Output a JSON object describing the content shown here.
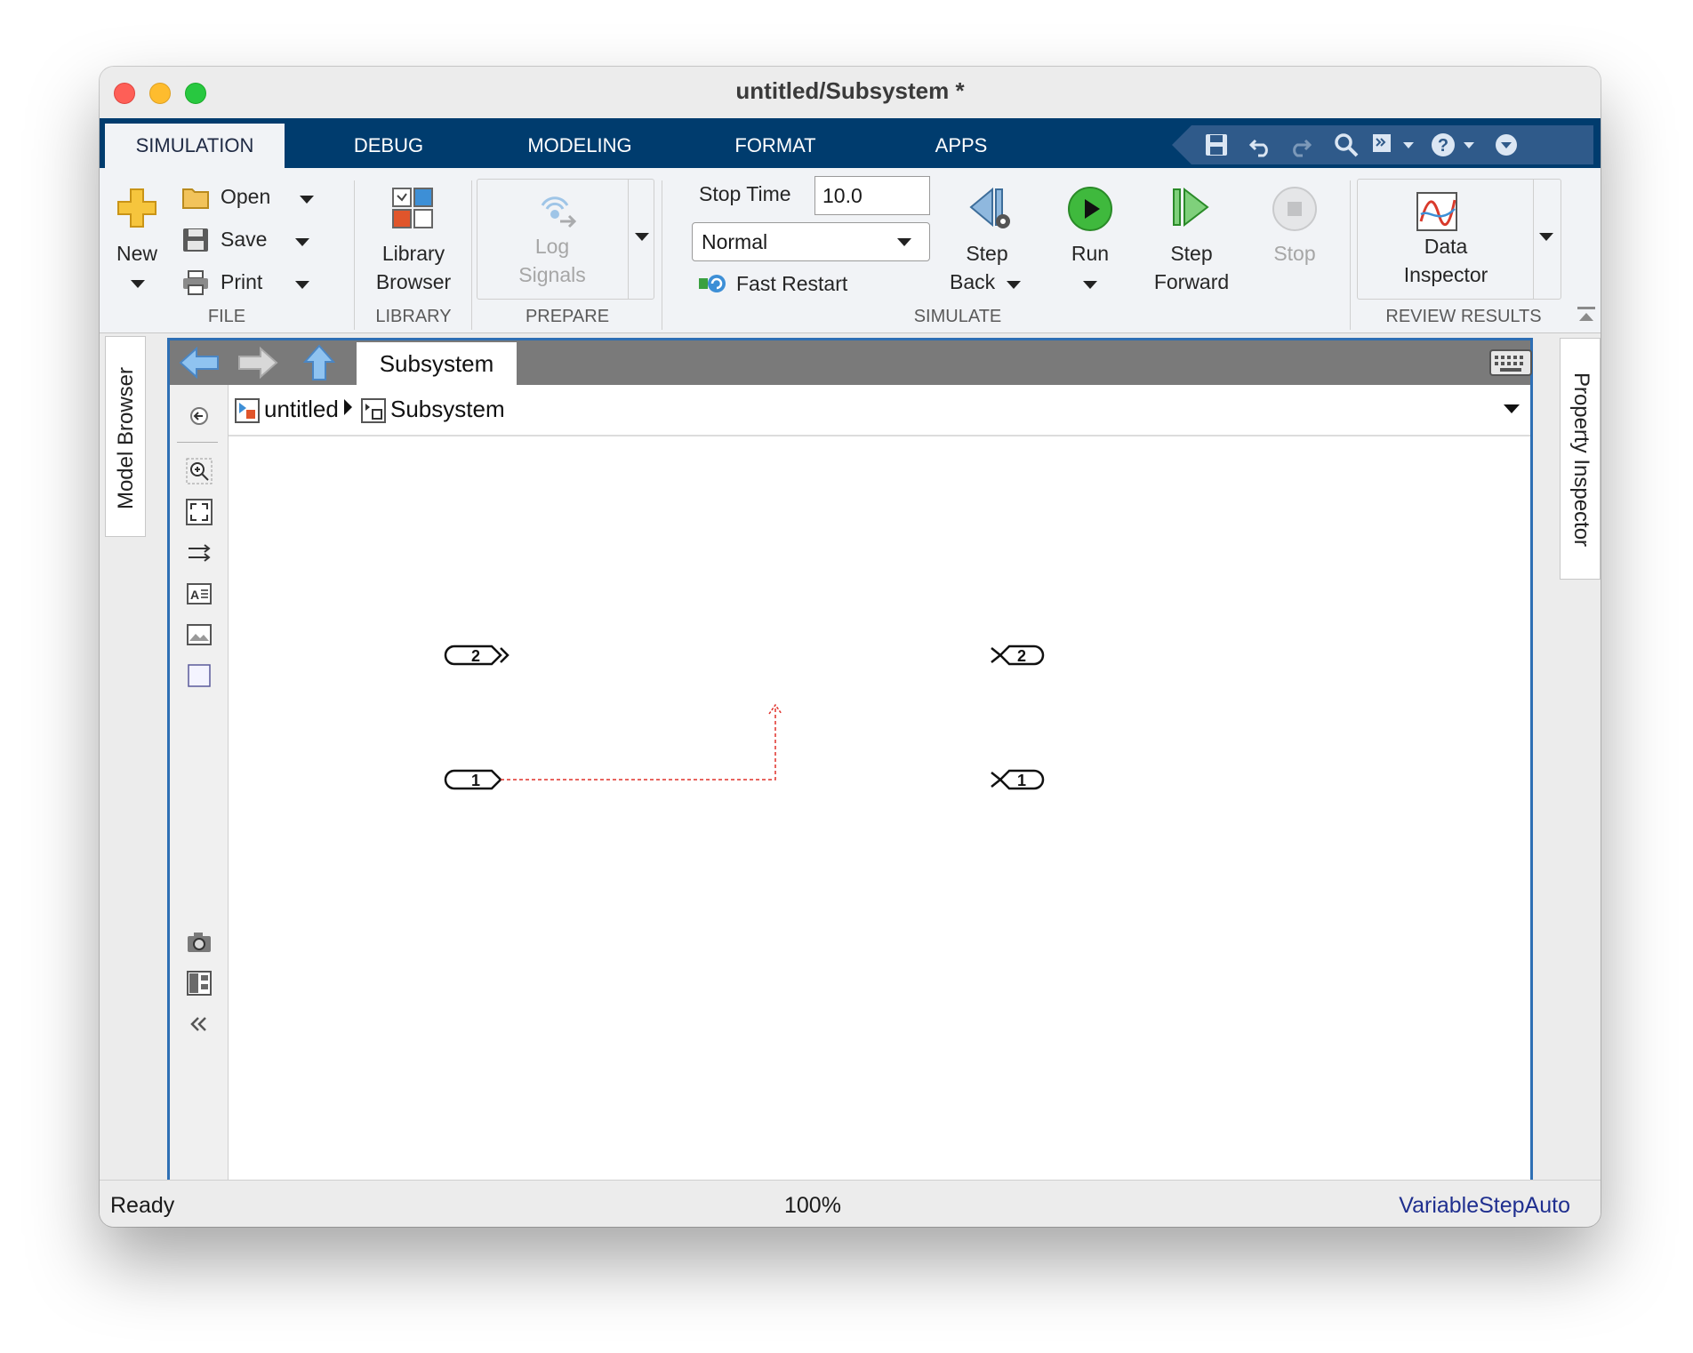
{
  "window": {
    "title": "untitled/Subsystem *"
  },
  "tabs": [
    {
      "label": "SIMULATION",
      "active": true
    },
    {
      "label": "DEBUG"
    },
    {
      "label": "MODELING"
    },
    {
      "label": "FORMAT"
    },
    {
      "label": "APPS"
    }
  ],
  "quick_access": [
    "save-icon",
    "undo-icon",
    "redo-icon",
    "search-icon",
    "apps-icon",
    "help-icon",
    "expand-icon"
  ],
  "ribbon": {
    "file": {
      "new_label": "New",
      "open_label": "Open",
      "save_label": "Save",
      "print_label": "Print",
      "group_title": "FILE"
    },
    "library": {
      "button_line1": "Library",
      "button_line2": "Browser",
      "group_title": "LIBRARY"
    },
    "prepare": {
      "button_line1": "Log",
      "button_line2": "Signals",
      "group_title": "PREPARE"
    },
    "simulate": {
      "stop_time_label": "Stop Time",
      "stop_time_value": "10.0",
      "mode_value": "Normal",
      "fast_restart_label": "Fast Restart",
      "step_back_line1": "Step",
      "step_back_line2": "Back",
      "run_label": "Run",
      "step_forward_line1": "Step",
      "step_forward_line2": "Forward",
      "stop_label": "Stop",
      "group_title": "SIMULATE"
    },
    "review": {
      "button_line1": "Data",
      "button_line2": "Inspector",
      "group_title": "REVIEW RESULTS"
    }
  },
  "side_panels": {
    "left": "Model Browser",
    "right": "Property Inspector"
  },
  "editor": {
    "tab_label": "Subsystem",
    "breadcrumb": {
      "root": "untitled",
      "current": "Subsystem"
    },
    "blocks": {
      "inport_1": "1",
      "inport_2": "2",
      "outport_1": "1",
      "outport_2": "2"
    }
  },
  "status": {
    "left": "Ready",
    "zoom": "100%",
    "solver": "VariableStepAuto"
  },
  "colors": {
    "tabbar": "#003c6e",
    "accent": "#2e6fb4",
    "signal_line": "#e0302a",
    "solver_link": "#1f2f8f"
  }
}
